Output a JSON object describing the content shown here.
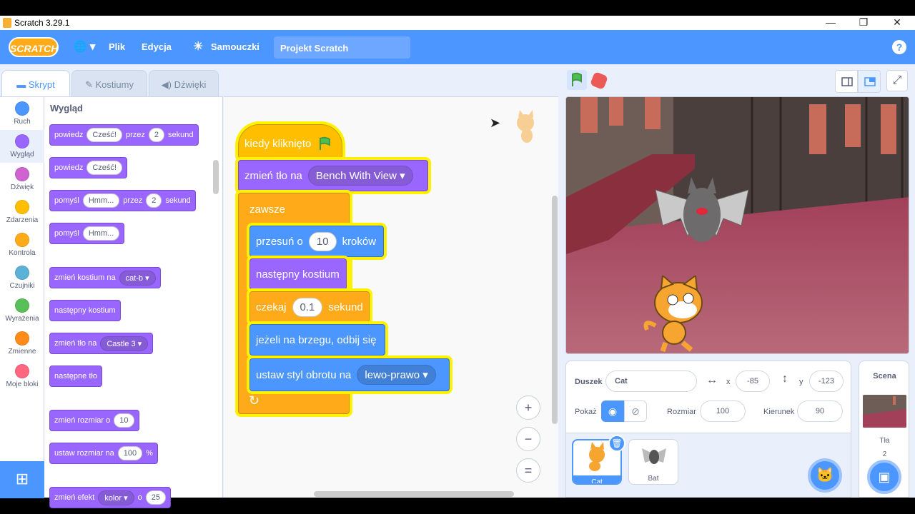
{
  "window": {
    "title": "Scratch 3.29.1",
    "minimize": "—",
    "restore": "❐",
    "close": "✕"
  },
  "menubar": {
    "logo": "SCRATCH",
    "globe": "🌐 ▾",
    "file": "Plik",
    "edit": "Edycja",
    "tutorials": "Samouczki",
    "project_title": "Projekt Scratch",
    "help": "?"
  },
  "tabs": {
    "code": "Skrypt",
    "costumes": "Kostiumy",
    "sounds": "Dźwięki"
  },
  "categories": [
    {
      "label": "Ruch",
      "color": "#4c97ff"
    },
    {
      "label": "Wygląd",
      "color": "#9966ff"
    },
    {
      "label": "Dźwięk",
      "color": "#cf63cf"
    },
    {
      "label": "Zdarzenia",
      "color": "#ffbf00"
    },
    {
      "label": "Kontrola",
      "color": "#ffab19"
    },
    {
      "label": "Czujniki",
      "color": "#5cb1d6"
    },
    {
      "label": "Wyrażenia",
      "color": "#59c059"
    },
    {
      "label": "Zmienne",
      "color": "#ff8c1a"
    },
    {
      "label": "Moje bloki",
      "color": "#ff6680"
    }
  ],
  "palette": {
    "heading": "Wygląd",
    "b1": {
      "a": "powiedz",
      "v": "Cześć!",
      "b": "przez",
      "n": "2",
      "c": "sekund"
    },
    "b2": {
      "a": "powiedz",
      "v": "Cześć!"
    },
    "b3": {
      "a": "pomyśl",
      "v": "Hmm...",
      "b": "przez",
      "n": "2",
      "c": "sekund"
    },
    "b4": {
      "a": "pomyśl",
      "v": "Hmm..."
    },
    "b5": {
      "a": "zmień kostium na",
      "v": "cat-b ▾"
    },
    "b6": {
      "a": "następny kostium"
    },
    "b7": {
      "a": "zmień tło na",
      "v": "Castle 3 ▾"
    },
    "b8": {
      "a": "następne tło"
    },
    "b9": {
      "a": "zmień rozmiar o",
      "v": "10"
    },
    "b10": {
      "a": "ustaw rozmiar na",
      "v": "100",
      "c": "%"
    },
    "b11": {
      "a": "zmień efekt",
      "v": "kolor ▾",
      "b": "o",
      "n": "25"
    }
  },
  "script": {
    "hat": "kiedy kliknięto",
    "switch_bg": "zmień tło na",
    "bg_value": "Bench With View ▾",
    "forever": "zawsze",
    "move": "przesuń o",
    "move_n": "10",
    "move_unit": "kroków",
    "next_costume": "następny kostium",
    "wait": "czekaj",
    "wait_n": "0.1",
    "wait_unit": "sekund",
    "bounce": "jeżeli na brzegu, odbij się",
    "rotation": "ustaw styl obrotu na",
    "rotation_value": "lewo-prawo ▾",
    "loop_arrow": "↻"
  },
  "zoom": {
    "in": "+",
    "out": "−",
    "reset": "="
  },
  "sprite": {
    "label_sprite": "Duszek",
    "name": "Cat",
    "label_x": "x",
    "x": "-85",
    "label_y": "y",
    "y": "-123",
    "label_show": "Pokaż",
    "label_size": "Rozmiar",
    "size": "100",
    "label_direction": "Kierunek",
    "direction": "90",
    "sprites": [
      "Cat",
      "Bat"
    ]
  },
  "stage_panel": {
    "label": "Scena",
    "backdrops_label": "Tła",
    "backdrops": "2"
  },
  "colors": {
    "accent": "#4c97ff",
    "looks": "#9966ff",
    "control": "#ffab19",
    "events": "#ffbf00",
    "motion": "#4c97ff"
  }
}
